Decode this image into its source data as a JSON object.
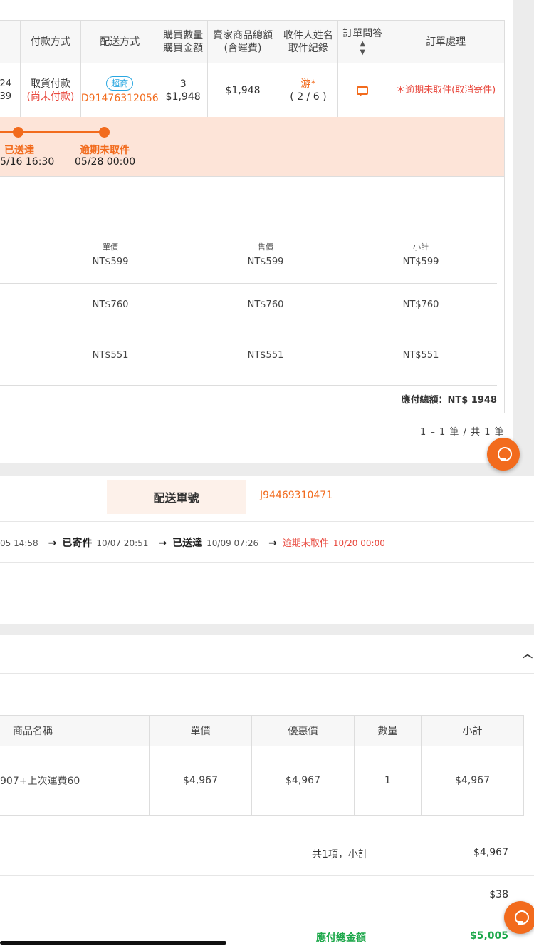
{
  "order_table": {
    "headers": {
      "payment": "付款方式",
      "shipping": "配送方式",
      "qty_line1": "購買數量",
      "qty_line2": "購買金額",
      "seller_total_line1": "賣家商品總額",
      "seller_total_line2": "(含運費)",
      "receiver_line1": "收件人姓名",
      "receiver_line2": "取件紀錄",
      "qa": "訂單問答",
      "process": "訂單處理"
    },
    "row": {
      "edge_line1": "24",
      "edge_line2": "39",
      "payment_method": "取貨付款",
      "payment_status": "(尚未付款)",
      "shipping_badge": "超商",
      "shipping_no": "D91476312056",
      "qty": "3",
      "amount": "$1,948",
      "seller_total": "$1,948",
      "receiver": "游*",
      "pickup_record": "( 2 / 6 )",
      "process_status": "＊逾期未取件(取消寄件)"
    }
  },
  "timeline": {
    "step1_label": "已送達",
    "step1_time": "5/16 16:30",
    "step2_label": "逾期未取件",
    "step2_time": "05/28 00:00"
  },
  "detail": {
    "headers": {
      "unit_price": "單價",
      "sale_price": "售價",
      "subtotal": "小計"
    },
    "rows": [
      {
        "unit_price": "NT$599",
        "sale_price": "NT$599",
        "subtotal": "NT$599"
      },
      {
        "unit_price": "NT$760",
        "sale_price": "NT$760",
        "subtotal": "NT$760"
      },
      {
        "unit_price": "NT$551",
        "sale_price": "NT$551",
        "subtotal": "NT$551"
      }
    ],
    "total_label": "應付總額：NT$ 1948"
  },
  "pagination": "1 – 1 筆 / 共 1 筆",
  "shipment": {
    "label": "配送單號",
    "number": "J94469310471",
    "track": [
      {
        "time": "05 14:58"
      },
      {
        "status": "已寄件",
        "time": "10/07 20:51"
      },
      {
        "status": "已送達",
        "time": "10/09 07:26"
      },
      {
        "status": "逾期未取件",
        "time": "10/20 00:00"
      }
    ]
  },
  "products": {
    "headers": {
      "name": "商品名稱",
      "unit_price": "單價",
      "discount_price": "優惠價",
      "qty": "數量",
      "subtotal": "小計"
    },
    "row": {
      "name": "907+上次運費60",
      "unit_price": "$4,967",
      "discount_price": "$4,967",
      "qty": "1",
      "subtotal": "$4,967"
    },
    "summary_count_label": "共1項，小計",
    "summary_subtotal": "$4,967",
    "shipping_fee": "$38",
    "grand_total_label": "應付總金額",
    "grand_total": "$5,005"
  },
  "icons": {
    "sort": "sort-icon",
    "message": "message-icon",
    "bulb": "lightbulb-icon",
    "arrow": "arrow-right-icon",
    "chevron": "chevron-up-icon"
  },
  "colors": {
    "accent": "#f26b1d",
    "alert": "#e8473c",
    "link_blue": "#29a7e1",
    "total_green": "#1ea84b",
    "timeline_bg": "#fde4d8"
  }
}
